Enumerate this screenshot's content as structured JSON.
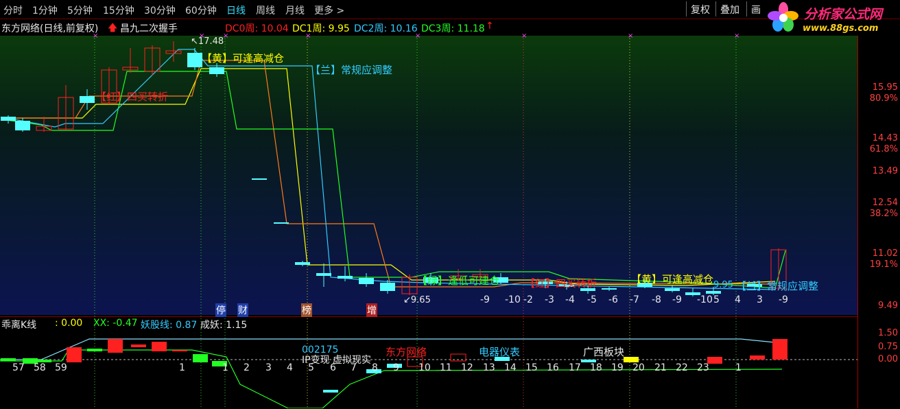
{
  "toolbar": {
    "periods": [
      "分时",
      "1分钟",
      "5分钟",
      "15分钟",
      "30分钟",
      "60分钟",
      "日线",
      "周线",
      "月线",
      "更多 >"
    ],
    "active_index": 6,
    "buttons": [
      "复权",
      "叠加",
      "画"
    ]
  },
  "logo": {
    "name": "分析家公式网",
    "url": "www.88gs.com"
  },
  "info": {
    "stock_title": "东方网络(日线,前复权)",
    "indicator_name": "昌九二次握手",
    "dc0": "DC0周: 10.04",
    "dc1": "DC1周: 9.95",
    "dc2": "DC2周: 10.16",
    "dc3": "DC3周: 11.18"
  },
  "main": {
    "high_label": "17.48",
    "low_label": "9.65",
    "annotations": [
      {
        "text": "【黄】可逢高减仓",
        "color": "#ffff00"
      },
      {
        "text": "【兰】常规应调整",
        "color": "#33ccff"
      },
      {
        "text": "【红】四买转折",
        "color": "#ff2020"
      },
      {
        "text": "【绿】逢低可建仓",
        "color": "#22ff22"
      },
      {
        "text": "【红】四买转折",
        "color": "#ff2020"
      },
      {
        "text": "【黄】可逢高减仓",
        "color": "#ffff00"
      },
      {
        "text": "【兰】常规应调整",
        "color": "#33ccff"
      },
      {
        "text": "9.95",
        "color": "#33ccff"
      }
    ],
    "markers": [
      "停",
      "财",
      "榜",
      "增"
    ],
    "counters": [
      "-9",
      "-10",
      "-2",
      "-3",
      "-4",
      "-5",
      "-6",
      "-7",
      "-8",
      "-9",
      "-10",
      "5",
      "4",
      "3",
      "-9"
    ],
    "y_labels": [
      {
        "value": "15.95",
        "pct": "80.9%"
      },
      {
        "value": "14.43",
        "pct": "61.8%"
      },
      {
        "value": "13.49",
        "pct": ""
      },
      {
        "value": "12.54",
        "pct": "38.2%"
      },
      {
        "value": "11.02",
        "pct": "19.1%"
      },
      {
        "value": "9.49",
        "pct": ""
      }
    ]
  },
  "sub": {
    "title": "乖离K线",
    "value0": ": 0.00",
    "xx": "XX: -0.47",
    "yao": "妖股线: 0.87",
    "cheng": "成妖: 1.15",
    "code": "002175",
    "slogan": "IP变现 虚拟现实",
    "name": "东方网络",
    "industry": "电器仪表",
    "region": "广西板块",
    "counts": [
      "57",
      "58",
      "59",
      "1",
      "1",
      "2",
      "3",
      "4",
      "5",
      "6",
      "7",
      "8",
      "9",
      "10",
      "11",
      "12",
      "13",
      "14",
      "15",
      "16",
      "17",
      "18",
      "19",
      "20",
      "21",
      "22",
      "23",
      "1"
    ],
    "y_labels": [
      "1.50",
      "0.75",
      "0.00"
    ]
  },
  "colors": {
    "up": "#ff2020",
    "down": "#55ffff",
    "yellow": "#ffff00",
    "cyan": "#33ccff",
    "green": "#22ff22",
    "orange": "#ff7a1a"
  }
}
